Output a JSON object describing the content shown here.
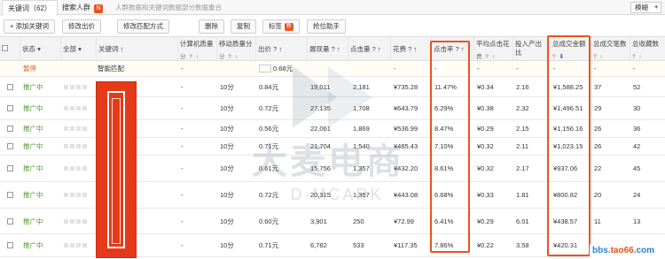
{
  "tabs": [
    {
      "label": "关键词（62）",
      "active": true
    },
    {
      "label": "搜索人群",
      "active": false,
      "badge": "N"
    }
  ],
  "tab_note": "人群数据和关键词数据部分数据重合",
  "mode_select": "模糊",
  "toolbar": {
    "add_keyword": "+ 添加关键词",
    "edit_bid": "修改出价",
    "edit_match": "修改匹配方式",
    "delete": "删除",
    "copy": "复制",
    "tag": "标签",
    "tag_badge": "新",
    "grab_helper": "抢位助手"
  },
  "columns": {
    "status": "状态",
    "all": "全部",
    "keyword": "关键词",
    "pc_score": "计算机质量",
    "pc_score_sub": "分",
    "mobile_score": "移动质量分",
    "mobile_score_sub": "分",
    "bid": "出价",
    "impressions": "展现量",
    "clicks": "点击量",
    "cost": "花费",
    "ctr": "点击率",
    "avg_cpc": "平均点击花",
    "avg_cpc_sub": "费",
    "roi": "投入产出比",
    "gmv": "总成交金额",
    "orders": "总成交笔数",
    "favorites": "总收藏数"
  },
  "smart_row": {
    "status": "暂停",
    "keyword": "智能匹配",
    "pc_score": "-",
    "bid": "0.68元",
    "cost": "-",
    "ctr": "-",
    "avg_cpc": "-",
    "roi": "-",
    "gmv": "-",
    "orders": "-",
    "favorites": "-"
  },
  "rows": [
    {
      "status": "推广中",
      "pc": "-",
      "mobile": "10分",
      "bid": "0.84元",
      "impr": "19,011",
      "clicks": "2,181",
      "cost": "¥735.28",
      "ctr": "11.47%",
      "cpc": "¥0.34",
      "roi": "2.16",
      "gmv": "¥1,588.25",
      "orders": "37",
      "fav": "52"
    },
    {
      "status": "推广中",
      "pc": "-",
      "mobile": "10分",
      "bid": "0.72元",
      "impr": "27,135",
      "clicks": "1,708",
      "cost": "¥643.79",
      "ctr": "6.29%",
      "cpc": "¥0.38",
      "roi": "2.32",
      "gmv": "¥1,496.51",
      "orders": "29",
      "fav": "30"
    },
    {
      "status": "推广中",
      "pc": "-",
      "mobile": "10分",
      "bid": "0.56元",
      "impr": "22,061",
      "clicks": "1,869",
      "cost": "¥536.99",
      "ctr": "8.47%",
      "cpc": "¥0.29",
      "roi": "2.15",
      "gmv": "¥1,156.16",
      "orders": "26",
      "fav": "36"
    },
    {
      "status": "推广中",
      "pc": "-",
      "mobile": "10分",
      "bid": "0.71元",
      "impr": "21,704",
      "clicks": "1,540",
      "cost": "¥485.43",
      "ctr": "7.10%",
      "cpc": "¥0.32",
      "roi": "2.11",
      "gmv": "¥1,023.15",
      "orders": "26",
      "fav": "42"
    },
    {
      "status": "推广中",
      "pc": "-",
      "mobile": "10分",
      "bid": "0.61元",
      "impr": "15,756",
      "clicks": "1,357",
      "cost": "¥432.20",
      "ctr": "8.61%",
      "cpc": "¥0.32",
      "roi": "2.17",
      "gmv": "¥937.06",
      "orders": "22",
      "fav": "45"
    },
    {
      "status": "推广中",
      "pc": "-",
      "mobile": "10分",
      "bid": "0.72元",
      "impr": "20,315",
      "clicks": "1,357",
      "cost": "¥443.08",
      "ctr": "6.68%",
      "cpc": "¥0.33",
      "roi": "1.81",
      "gmv": "¥800.82",
      "orders": "20",
      "fav": "24"
    },
    {
      "status": "推广中",
      "pc": "-",
      "mobile": "10分",
      "bid": "0.60元",
      "impr": "3,901",
      "clicks": "250",
      "cost": "¥72.99",
      "ctr": "6.41%",
      "cpc": "¥0.29",
      "roi": "6.01",
      "gmv": "¥438.57",
      "orders": "11",
      "fav": "13"
    },
    {
      "status": "推广中",
      "pc": "-",
      "mobile": "10分",
      "bid": "0.71元",
      "impr": "6,782",
      "clicks": "533",
      "cost": "¥117.35",
      "ctr": "7.86%",
      "cpc": "¥0.22",
      "roi": "3.58",
      "gmv": "¥420.31",
      "orders": "",
      "fav": "12"
    }
  ],
  "watermark": {
    "main": "大麦电商",
    "sub": "D-MCARK"
  },
  "footer_logo": {
    "part1": "bbs.",
    "part2": "tao66",
    "part3": ".com"
  },
  "colors": {
    "accent": "#e8541e",
    "active_status": "#4a9a2e",
    "sort_blue": "#1f76c8"
  }
}
